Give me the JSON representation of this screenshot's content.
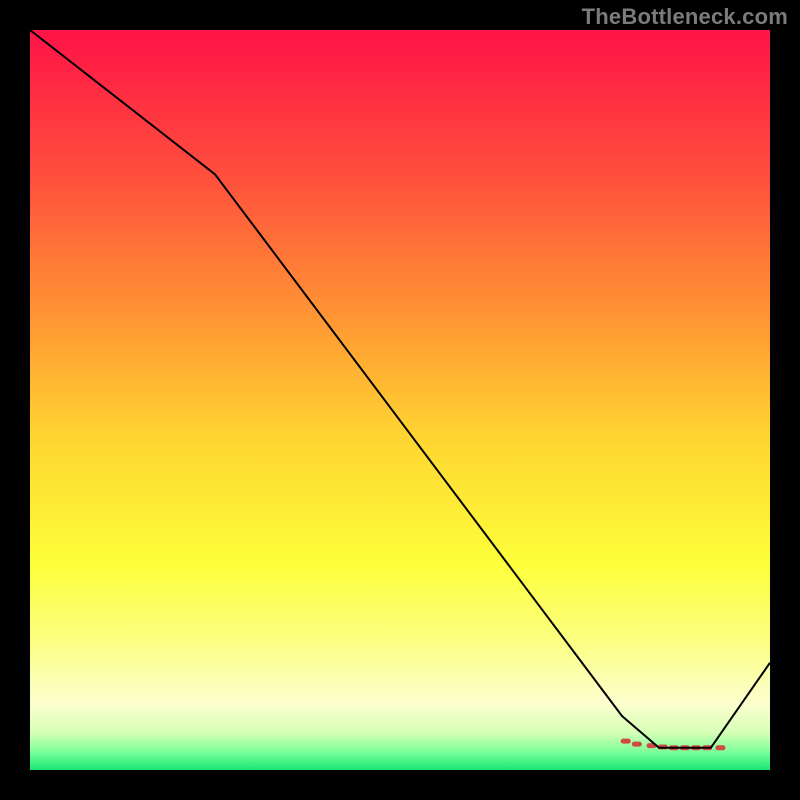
{
  "watermark": "TheBottleneck.com",
  "chart_data": {
    "type": "line",
    "title": "",
    "xlabel": "",
    "ylabel": "",
    "xlim": [
      0,
      100
    ],
    "ylim": [
      0,
      100
    ],
    "background_gradient": {
      "direction": "vertical",
      "stops": [
        {
          "offset": 0.0,
          "color": "#ff1347"
        },
        {
          "offset": 0.2,
          "color": "#ff503c"
        },
        {
          "offset": 0.4,
          "color": "#ff9a33"
        },
        {
          "offset": 0.55,
          "color": "#ffd531"
        },
        {
          "offset": 0.72,
          "color": "#fdff3a"
        },
        {
          "offset": 0.82,
          "color": "#fbff7d"
        },
        {
          "offset": 0.91,
          "color": "#fcffce"
        },
        {
          "offset": 0.95,
          "color": "#d6ffb6"
        },
        {
          "offset": 0.975,
          "color": "#7dff9a"
        },
        {
          "offset": 1.0,
          "color": "#19e676"
        }
      ]
    },
    "series": [
      {
        "name": "bottleneck-curve",
        "color": "#000000",
        "stroke_width": 2,
        "x": [
          0,
          25,
          80,
          85,
          92,
          100
        ],
        "values": [
          100,
          80.5,
          7.3,
          3.0,
          3.0,
          14.5
        ]
      }
    ],
    "markers": {
      "name": "highlight-band",
      "color": "#cf4a42",
      "x": [
        80.5,
        82,
        84,
        85.5,
        87,
        88.5,
        90,
        91.5,
        93.3
      ],
      "values": [
        3.9,
        3.5,
        3.3,
        3.1,
        3.0,
        3.0,
        3.0,
        3.0,
        3.0
      ]
    }
  }
}
